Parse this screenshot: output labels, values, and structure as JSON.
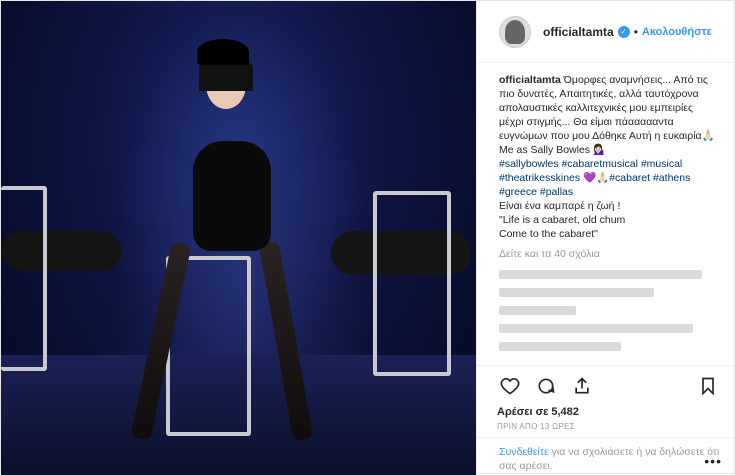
{
  "header": {
    "username": "officialtamta",
    "separator": "•",
    "follow_label": "Ακολουθήστε"
  },
  "caption": {
    "username": "officialtamta",
    "text_1": "Όμορφες αναμνήσεις... Από τις πιο δυνατές, Απαιτητικές, αλλά ταυτόχρονα απολαυστικές καλλιτεχνικές μου εμπειρίες μέχρι στιγμής... Θα είμαι πάαααααντα ευγνώμων που μου Δόθηκε Αυτή η ευκαιρία🙏🏻 Me as Sally Bowles 💁🏻‍♀️",
    "hashtags_1": "#sallybowles #cabaretmusical #musical #theatrikesskines 💜🙏🏻#cabaret #athens #greece #pallas",
    "line_2": "Είναι ένα καμπαρέ η ζωή !",
    "line_3": "\"Life is a cabaret, old chum",
    "line_4": "Come to the cabaret\""
  },
  "view_all_comments": "Δείτε και τα 40 σχόλια",
  "likes": "Αρέσει σε 5,482",
  "timestamp": "ΠΡΙΝ ΑΠΟ 13 ΩΡΕΣ",
  "login": {
    "link": "Συνδεθείτε",
    "text": " για να σχολιάσετε ή να δηλώσετε ότι σας αρέσει."
  },
  "more_label": "•••",
  "icons": [
    "heart-icon",
    "comment-icon",
    "share-icon",
    "bookmark-icon"
  ],
  "colors": {
    "accent": "#3897f0",
    "hashtag": "#003569",
    "muted": "#999999"
  }
}
